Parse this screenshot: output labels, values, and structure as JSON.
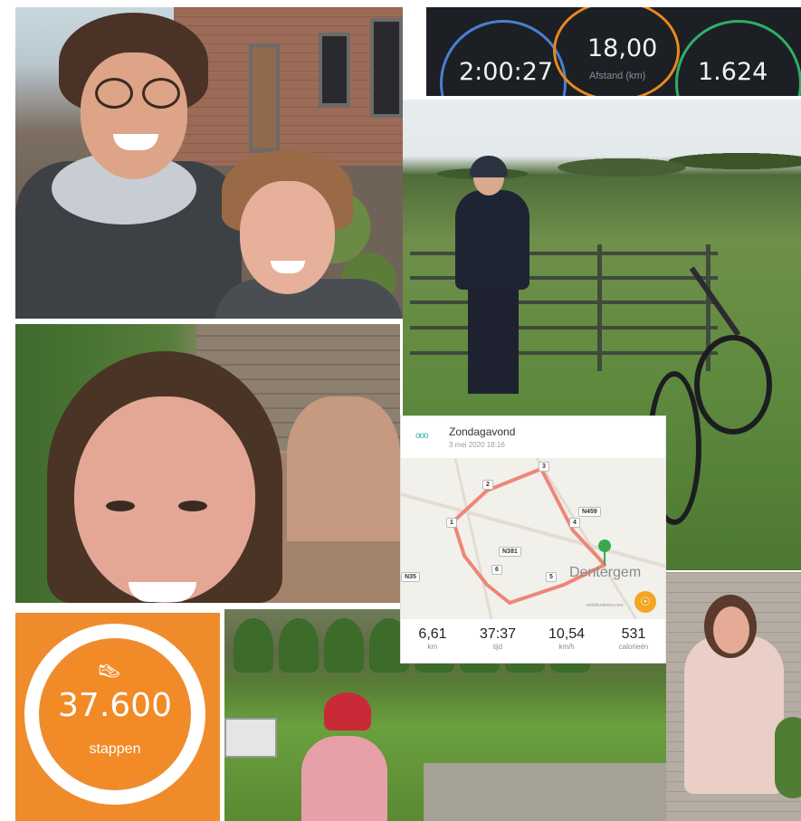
{
  "stats_bar": {
    "time": "2:00:27",
    "distance": "18,00",
    "distance_label": "Afstand (km)",
    "calories": "1.624",
    "ring_colors": [
      "#4a7fd1",
      "#e8891e",
      "#2fae6a"
    ]
  },
  "route_card": {
    "logo": "ooo",
    "title": "Zondagavond",
    "date": "3 mei 2020 18:16",
    "map_labels": {
      "road_main": "N381",
      "road_north": "N459",
      "road_west": "N35",
      "town": "Dentergem",
      "attribution": "mobilesdemo.com"
    },
    "km_markers": [
      "1",
      "2",
      "3",
      "4",
      "5",
      "6"
    ],
    "metrics": [
      {
        "value": "6,61",
        "unit": "km"
      },
      {
        "value": "37:37",
        "unit": "tijd"
      },
      {
        "value": "10,54",
        "unit": "km/h"
      },
      {
        "value": "531",
        "unit": "calorieën"
      }
    ],
    "route_color": "#ee8677"
  },
  "steps_tile": {
    "count": "37.600",
    "unit": "stappen",
    "icon": "shoe-icon",
    "accent": "#f08b2c"
  }
}
